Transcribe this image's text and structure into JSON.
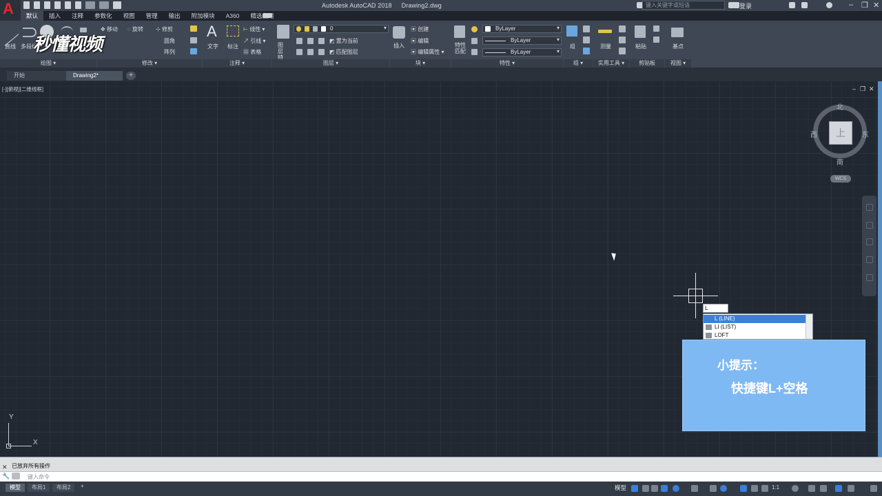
{
  "window": {
    "app_title": "Autodesk AutoCAD 2018",
    "file_title": "Drawing2.dwg",
    "search_placeholder": "键入关键字或短语",
    "login_label": "登录",
    "app_logo": "A"
  },
  "ribbon_tabs": [
    "默认",
    "插入",
    "注释",
    "参数化",
    "视图",
    "管理",
    "输出",
    "附加模块",
    "A360",
    "精选应用"
  ],
  "ribbon": {
    "draw": {
      "line": "直线",
      "polyline": "多段线",
      "footer": "绘图 ▾"
    },
    "modify": {
      "move": "移动",
      "rotate": "旋转",
      "trim": "修剪",
      "fillet": "圆角",
      "array": "阵列",
      "footer": "修改 ▾"
    },
    "annotation": {
      "text": "文字",
      "dimension": "标注",
      "linear": "线性",
      "leader": "引线",
      "table": "表格",
      "footer": "注释 ▾"
    },
    "layers": {
      "layer_properties": "图层特性",
      "current_layer": "0",
      "make_current": "置为当前",
      "match_layer": "匹配图层",
      "footer": "图层 ▾"
    },
    "block": {
      "insert": "插入",
      "create": "创建",
      "edit": "编辑",
      "edit_attributes": "编辑属性",
      "footer": "块 ▾"
    },
    "properties": {
      "match": "特性匹配",
      "color": "ByLayer",
      "linetype": "ByLayer",
      "lineweight": "ByLayer",
      "footer": "特性 ▾"
    },
    "groups": {
      "group": "组",
      "footer": "组 ▾"
    },
    "utilities": {
      "measure": "测量",
      "footer": "实用工具 ▾"
    },
    "clipboard": {
      "paste": "粘贴",
      "footer": "剪贴板"
    },
    "view": {
      "base": "基点",
      "footer": "视图 ▾"
    }
  },
  "file_tabs": [
    "开始",
    "Drawing2*"
  ],
  "viewport": {
    "label": "[-][俯视][二维线框]"
  },
  "viewcube": {
    "north": "北",
    "south": "南",
    "east": "东",
    "west": "西",
    "face": "上",
    "wcs": "WCS"
  },
  "dynamic_input": {
    "value": "L"
  },
  "autocomplete": [
    "L (LINE)",
    "LI (LIST)",
    "LOFT"
  ],
  "tip": {
    "title": "小提示：",
    "body": "快捷键L+空格"
  },
  "ucs": {
    "x": "X",
    "y": "Y"
  },
  "command_line": {
    "history": "已放弃所有操作",
    "placeholder": "键入命令"
  },
  "layout_tabs": [
    "模型",
    "布局1",
    "布局2"
  ],
  "status": {
    "model": "模型",
    "scale": "1:1"
  },
  "watermark": "秒懂视频",
  "colors": {
    "canvas": "#212831",
    "ribbon": "#3e4753",
    "tip_box": "#7fb9f3",
    "accent_red": "#e8262c",
    "selection": "#3b7fd6"
  }
}
